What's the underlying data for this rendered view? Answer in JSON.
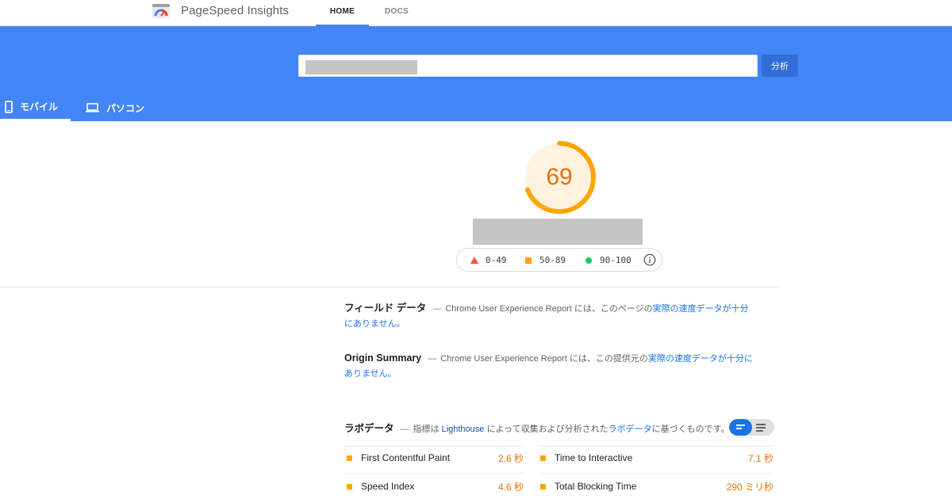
{
  "app": {
    "brand": "PageSpeed Insights",
    "nav": [
      {
        "label": "HOME",
        "active": true
      },
      {
        "label": "DOCS",
        "active": false
      }
    ]
  },
  "search": {
    "value": "",
    "button": "分析"
  },
  "device_tabs": [
    {
      "label": "モバイル",
      "icon": "phone-icon",
      "active": true
    },
    {
      "label": "パソコン",
      "icon": "laptop-icon",
      "active": false
    }
  ],
  "score": {
    "value": "69",
    "fraction": 0.69,
    "color": "#ffa400"
  },
  "legend": [
    {
      "range": "0-49",
      "icon": "triangle-red",
      "color": "#ff4e42"
    },
    {
      "range": "50-89",
      "icon": "square-orange",
      "color": "#ffa400"
    },
    {
      "range": "90-100",
      "icon": "circle-green",
      "color": "#0cce6b"
    }
  ],
  "field": {
    "title": "フィールド データ",
    "text_a": "Chrome User Experience Report には、このページの",
    "link": "実際の速度データが十分にありません。"
  },
  "origin": {
    "title": "Origin Summary",
    "text_a": "Chrome User Experience Report には、この提供元の",
    "link": "実際の速度データが十分にありません。"
  },
  "lab": {
    "title": "ラボデータ",
    "text_a": "指標は",
    "lighthouse": "Lighthouse",
    "text_b": "によって収集および分析された",
    "link": "ラボデータ",
    "text_c": "に基づくものです。"
  },
  "metrics": [
    {
      "name": "First Contentful Paint",
      "value": "2.6 秒"
    },
    {
      "name": "Time to Interactive",
      "value": "7.1 秒"
    },
    {
      "name": "Speed Index",
      "value": "4.6 秒"
    },
    {
      "name": "Total Blocking Time",
      "value": "290 ミリ秒"
    }
  ],
  "colors": {
    "header": "#4285f4",
    "accent": "#1a73e8",
    "average": "#ffa400"
  }
}
